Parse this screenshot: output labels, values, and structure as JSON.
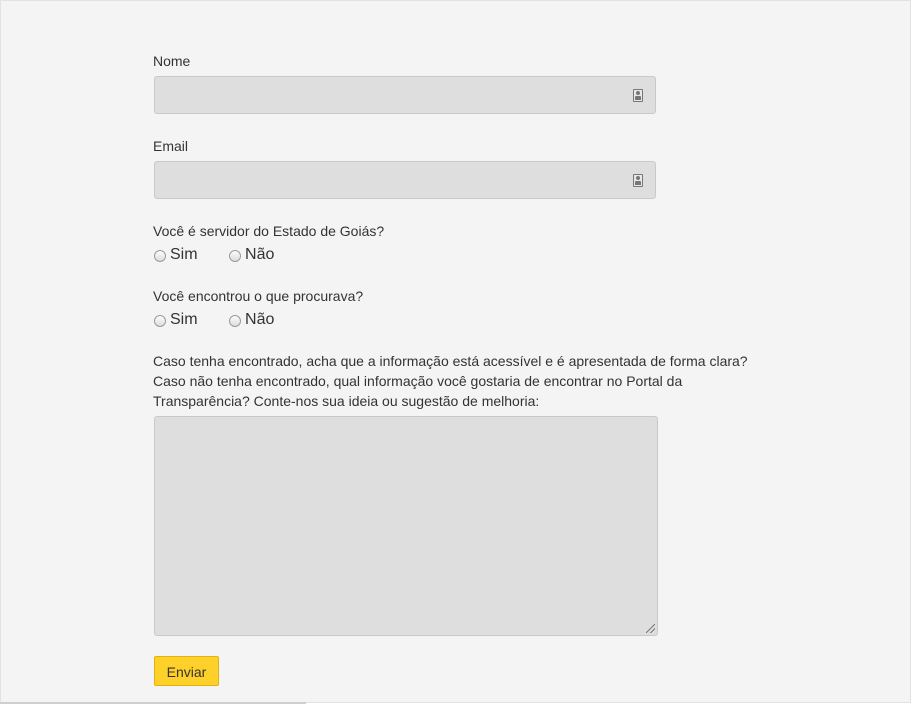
{
  "form": {
    "name": {
      "label": "Nome",
      "value": "",
      "icon": "contact-card-icon"
    },
    "email": {
      "label": "Email",
      "value": "",
      "icon": "contact-card-icon"
    },
    "servidor_question": {
      "label": "Você é servidor do Estado de Goiás?",
      "options": [
        "Sim",
        "Não"
      ],
      "selected": null
    },
    "encontrou_question": {
      "label": "Você encontrou o que procurava?",
      "options": [
        "Sim",
        "Não"
      ],
      "selected": null
    },
    "feedback": {
      "lines": [
        "Caso tenha encontrado, acha que a informação está acessível e é apresentada de forma clara?",
        "Caso não tenha encontrado, qual informação você gostaria de encontrar no Portal da",
        "Transparência? Conte-nos sua ideia ou sugestão de melhoria:"
      ],
      "value": ""
    },
    "submit_label": "Enviar"
  },
  "colors": {
    "page_background": "#f4f4f4",
    "input_background": "#dedede",
    "button_background": "#fdd02a",
    "text": "#333333"
  }
}
